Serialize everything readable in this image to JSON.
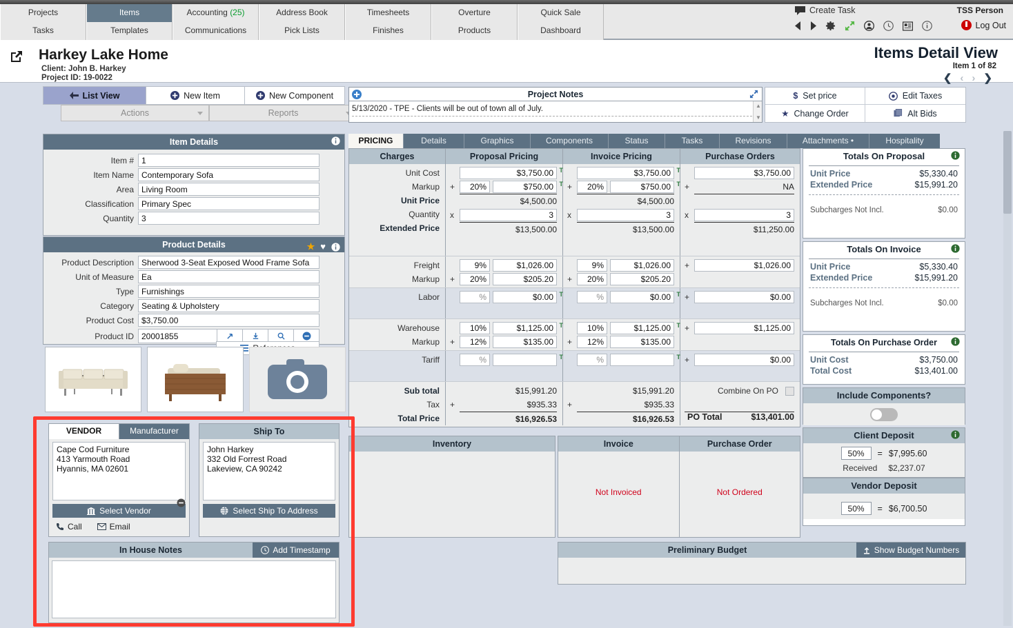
{
  "nav": {
    "row1": [
      {
        "label": "Projects",
        "active": false
      },
      {
        "label": "Items",
        "active": true
      },
      {
        "label": "Accounting",
        "count": "(25)",
        "active": false
      },
      {
        "label": "Address Book",
        "active": false
      },
      {
        "label": "Timesheets",
        "active": false
      },
      {
        "label": "Overture",
        "active": false
      },
      {
        "label": "Quick Sale",
        "active": false
      }
    ],
    "row2": [
      {
        "label": "Tasks",
        "active": false
      },
      {
        "label": "Templates",
        "active": false
      },
      {
        "label": "Communications",
        "active": false
      },
      {
        "label": "Pick Lists",
        "active": false
      },
      {
        "label": "Finishes",
        "active": false
      },
      {
        "label": "Products",
        "active": false
      },
      {
        "label": "Dashboard",
        "active": false
      }
    ],
    "create_task": "Create Task",
    "user": "TSS Person",
    "logout": "Log Out",
    "icons": [
      "prev-arrow-icon",
      "next-arrow-icon",
      "gear-icon",
      "expand-icon",
      "user-icon",
      "clock-icon",
      "card-icon",
      "info-icon"
    ]
  },
  "project": {
    "title": "Harkey Lake Home",
    "client": "Client: John B. Harkey",
    "project_id": "Project ID: 19-0022",
    "view_title": "Items Detail View",
    "item_counter": "Item 1 of 82"
  },
  "toolbar": {
    "list_view": "List View",
    "new_item": "New Item",
    "new_component": "New Component",
    "actions": "Actions",
    "reports": "Reports"
  },
  "project_notes": {
    "title": "Project Notes",
    "note": "5/13/2020 - TPE - Clients will be out of town all of July."
  },
  "action_buttons": [
    {
      "label": "Set price",
      "icon": "dollar-icon"
    },
    {
      "label": "Edit Taxes",
      "icon": "target-icon"
    },
    {
      "label": "Change Order",
      "icon": "star-icon"
    },
    {
      "label": "Alt Bids",
      "icon": "copy-icon"
    }
  ],
  "item_details": {
    "title": "Item Details",
    "fields": [
      {
        "label": "Item #",
        "value": "1"
      },
      {
        "label": "Item Name",
        "value": "Contemporary Sofa"
      },
      {
        "label": "Area",
        "value": "Living Room"
      },
      {
        "label": "Classification",
        "value": "Primary Spec"
      },
      {
        "label": "Quantity",
        "value": "3"
      }
    ]
  },
  "product_details": {
    "title": "Product Details",
    "fields": [
      {
        "label": "Product Description",
        "value": "Sherwood 3-Seat Exposed Wood Frame Sofa"
      },
      {
        "label": "Unit of Measure",
        "value": "Ea"
      },
      {
        "label": "Type",
        "value": "Furnishings"
      },
      {
        "label": "Category",
        "value": "Seating & Upholstery"
      },
      {
        "label": "Product Cost",
        "value": "$3,750.00"
      }
    ],
    "product_id_label": "Product ID",
    "product_id": "20001855",
    "references": "References",
    "icons": [
      "star-icon",
      "heart-icon",
      "info-icon"
    ]
  },
  "vendor": {
    "tab_vendor": "VENDOR",
    "tab_manufacturer": "Manufacturer",
    "address": "Cape Cod Furniture\n413 Yarmouth Road\nHyannis, MA 02601",
    "select_button": "Select Vendor",
    "call": "Call",
    "email": "Email"
  },
  "ship_to": {
    "title": "Ship To",
    "address": "John Harkey\n332 Old Forrest Road\nLakeview, CA 90242",
    "select_button": "Select Ship To Address"
  },
  "in_house_notes": {
    "title": "In House Notes",
    "add_timestamp": "Add Timestamp",
    "value": ""
  },
  "pricing": {
    "tabs": [
      {
        "label": "PRICING",
        "active": true
      },
      {
        "label": "Details",
        "active": false
      },
      {
        "label": "Graphics",
        "active": false
      },
      {
        "label": "Components",
        "active": false
      },
      {
        "label": "Status",
        "active": false
      },
      {
        "label": "Tasks",
        "active": false
      },
      {
        "label": "Revisions",
        "active": false
      },
      {
        "label": "Attachments •",
        "active": false
      },
      {
        "label": "Hospitality",
        "active": false
      }
    ],
    "columns": [
      "Charges",
      "Proposal Pricing",
      "Invoice Pricing",
      "Purchase Orders"
    ],
    "unit_cost_label": "Unit Cost",
    "markup_label": "Markup",
    "unit_price_label": "Unit Price",
    "quantity_label": "Quantity",
    "extended_price_label": "Extended Price",
    "freight_label": "Freight",
    "labor_label": "Labor",
    "warehouse_label": "Warehouse",
    "tariff_label": "Tariff",
    "subtotal_label": "Sub total",
    "tax_label": "Tax",
    "total_price_label": "Total Price",
    "combine_on_po": "Combine On PO",
    "po_total_label": "PO Total",
    "proposal": {
      "unit_cost": "$3,750.00",
      "markup_pct": "20%",
      "markup_amt": "$750.00",
      "unit_price": "$4,500.00",
      "quantity": "3",
      "extended_price": "$13,500.00",
      "freight_pct": "9%",
      "freight_amt": "$1,026.00",
      "freight_markup_pct": "20%",
      "freight_markup_amt": "$205.20",
      "labor_pct": "%",
      "labor_amt": "$0.00",
      "warehouse_pct": "10%",
      "warehouse_amt": "$1,125.00",
      "warehouse_markup_pct": "12%",
      "warehouse_markup_amt": "$135.00",
      "tariff_pct": "%",
      "tariff_amt": "",
      "subtotal": "$15,991.20",
      "tax": "$935.33",
      "total_price": "$16,926.53"
    },
    "invoice": {
      "unit_cost": "$3,750.00",
      "markup_pct": "20%",
      "markup_amt": "$750.00",
      "unit_price": "$4,500.00",
      "quantity": "3",
      "extended_price": "$13,500.00",
      "freight_pct": "9%",
      "freight_amt": "$1,026.00",
      "freight_markup_pct": "20%",
      "freight_markup_amt": "$205.20",
      "labor_pct": "%",
      "labor_amt": "$0.00",
      "warehouse_pct": "10%",
      "warehouse_amt": "$1,125.00",
      "warehouse_markup_pct": "12%",
      "warehouse_markup_amt": "$135.00",
      "tariff_pct": "%",
      "tariff_amt": "",
      "subtotal": "$15,991.20",
      "tax": "$935.33",
      "total_price": "$16,926.53"
    },
    "purchase_orders": {
      "unit_cost": "$3,750.00",
      "markup": "NA",
      "quantity": "3",
      "extended_price": "$11,250.00",
      "freight_amt": "$1,026.00",
      "labor_amt": "$0.00",
      "warehouse_amt": "$1,125.00",
      "tariff_amt": "$0.00",
      "po_total": "$13,401.00"
    }
  },
  "inventory": {
    "title": "Inventory"
  },
  "invoice_box": {
    "title": "Invoice",
    "status": "Not Invoiced"
  },
  "purchase_order_box": {
    "title": "Purchase Order",
    "status": "Not Ordered"
  },
  "preliminary_budget": {
    "title": "Preliminary Budget",
    "button": "Show Budget Numbers"
  },
  "totals_proposal": {
    "title": "Totals On Proposal",
    "unit_price_label": "Unit Price",
    "unit_price": "$5,330.40",
    "extended_price_label": "Extended Price",
    "extended_price": "$15,991.20",
    "subcharges_label": "Subcharges Not Incl.",
    "subcharges": "$0.00"
  },
  "totals_invoice": {
    "title": "Totals On Invoice",
    "unit_price_label": "Unit Price",
    "unit_price": "$5,330.40",
    "extended_price_label": "Extended Price",
    "extended_price": "$15,991.20",
    "subcharges_label": "Subcharges Not Incl.",
    "subcharges": "$0.00"
  },
  "totals_po": {
    "title": "Totals On Purchase Order",
    "unit_cost_label": "Unit Cost",
    "unit_cost": "$3,750.00",
    "total_cost_label": "Total Cost",
    "total_cost": "$13,401.00"
  },
  "include_components": {
    "title": "Include Components?",
    "state": "off"
  },
  "client_deposit": {
    "title": "Client Deposit",
    "percent": "50%",
    "equals": "=",
    "amount": "$7,995.60",
    "received_label": "Received",
    "received": "$2,237.07"
  },
  "vendor_deposit": {
    "title": "Vendor Deposit",
    "percent": "50%",
    "equals": "=",
    "amount": "$6,700.50"
  },
  "colors": {
    "header_dark": "#5c7183",
    "header_light": "#b4c2cc",
    "accent_red": "#ff3b30",
    "status_red": "#d0021b",
    "active_tab": "#657b8c",
    "page_bg": "#d7dde8",
    "tax_marker_green": "#2d7a3f",
    "accent_green": "#0a9c2f"
  }
}
